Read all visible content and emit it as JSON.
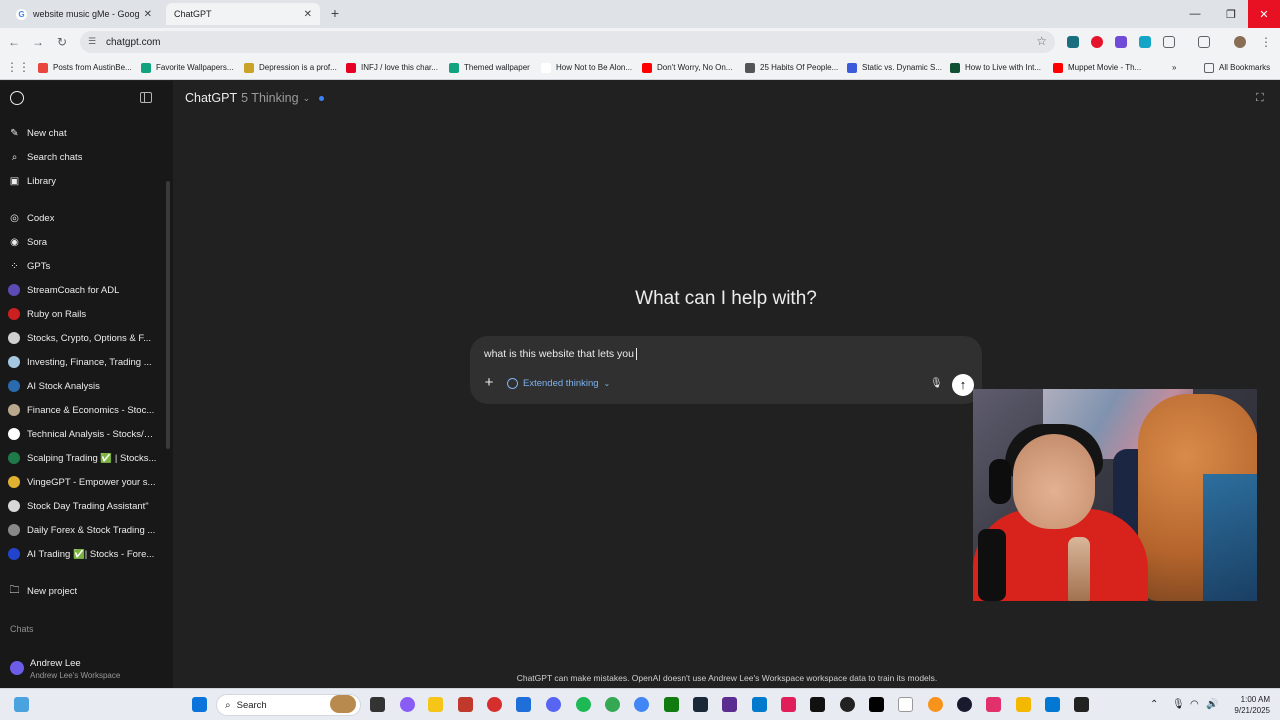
{
  "browser": {
    "tabs": [
      {
        "title": "website music gMe - Google Se",
        "active": false
      },
      {
        "title": "ChatGPT",
        "active": true
      }
    ],
    "url": "chatgpt.com",
    "bookmarks": [
      {
        "label": "Posts from AustinBe...",
        "color": "#e8453c"
      },
      {
        "label": "Favorite Wallpapers...",
        "color": "#10a37f"
      },
      {
        "label": "Depression is a prof...",
        "color": "#c9a227"
      },
      {
        "label": "INFJ / love this char...",
        "color": "#e60023"
      },
      {
        "label": "Themed wallpaper",
        "color": "#10a37f"
      },
      {
        "label": "How Not to Be Alon...",
        "color": "#ffffff"
      },
      {
        "label": "Don't Worry, No On...",
        "color": "#ff0000"
      },
      {
        "label": "25 Habits Of People...",
        "color": "#555555"
      },
      {
        "label": "Static vs. Dynamic S...",
        "color": "#3b5bdb"
      },
      {
        "label": "How to Live with Int...",
        "color": "#0f5132"
      },
      {
        "label": "Muppet Movie - Th...",
        "color": "#ff0000"
      }
    ],
    "all_bookmarks": "All Bookmarks"
  },
  "sidebar": {
    "nav": [
      {
        "label": "New chat",
        "icon": "pencil-icon"
      },
      {
        "label": "Search chats",
        "icon": "search-icon"
      },
      {
        "label": "Library",
        "icon": "library-icon"
      }
    ],
    "apps": [
      {
        "label": "Codex",
        "icon": "codex-icon"
      },
      {
        "label": "Sora",
        "icon": "sora-icon"
      },
      {
        "label": "GPTs",
        "icon": "grid-icon"
      }
    ],
    "gpts": [
      {
        "label": "StreamCoach for ADL",
        "color": "#5b4bb5"
      },
      {
        "label": "Ruby on Rails",
        "color": "#cc1f1f"
      },
      {
        "label": "Stocks, Crypto, Options & F...",
        "color": "#d0d0d0"
      },
      {
        "label": "Investing, Finance, Trading ...",
        "color": "#a5c8e0"
      },
      {
        "label": "AI Stock Analysis",
        "color": "#2a6bb0"
      },
      {
        "label": "Finance & Economics - Stoc...",
        "color": "#b8a98c"
      },
      {
        "label": "Technical Analysis - Stocks/C...",
        "color": "#ffffff"
      },
      {
        "label": "Scalping Trading ✅ | Stocks...",
        "color": "#1f7a4a"
      },
      {
        "label": "VingeGPT - Empower your s...",
        "color": "#e0b030"
      },
      {
        "label": "Stock Day Trading Assistant\"",
        "color": "#d8d8d8"
      },
      {
        "label": "Daily Forex & Stock Trading ...",
        "color": "#888888"
      },
      {
        "label": "AI Trading ✅| Stocks - Fore...",
        "color": "#2244cc"
      }
    ],
    "new_project": "New project",
    "chats_heading": "Chats",
    "user": {
      "name": "Andrew Lee",
      "workspace": "Andrew Lee's Workspace"
    }
  },
  "main": {
    "brand": "ChatGPT",
    "model": "5 Thinking",
    "hero": "What can I help with?",
    "composer": {
      "value": "what is this website that lets you",
      "mode": "Extended thinking"
    },
    "disclaimer": "ChatGPT can make mistakes. OpenAI doesn't use Andrew Lee's Workspace workspace data to train its models."
  },
  "taskbar": {
    "search_label": "Search",
    "time": "1:00 AM",
    "date": "9/21/2025"
  }
}
